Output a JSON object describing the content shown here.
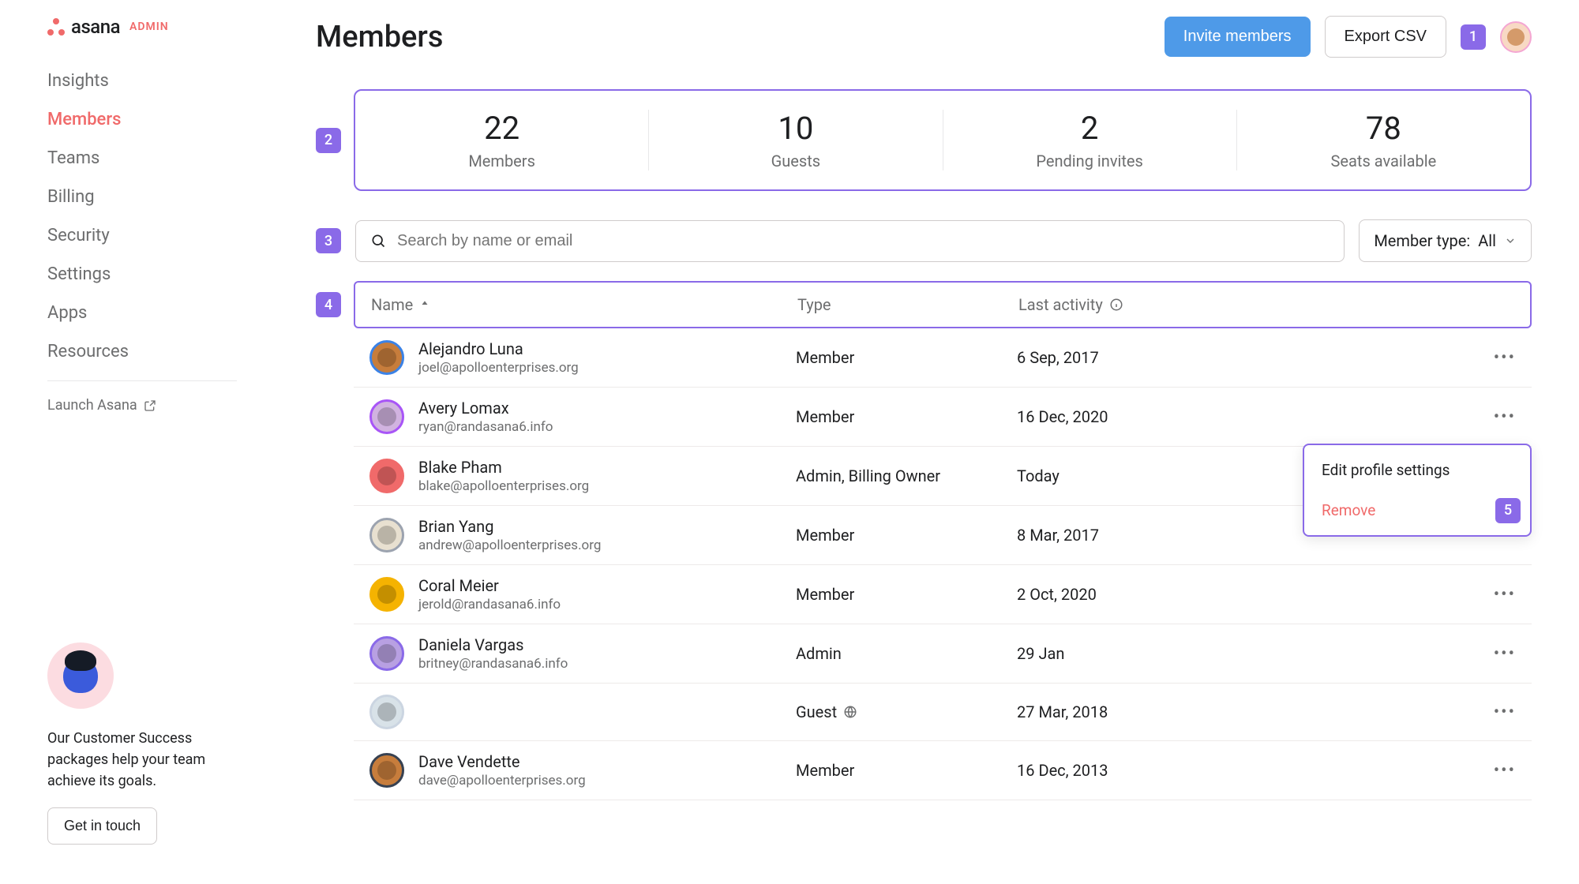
{
  "brand": {
    "name": "asana",
    "suffix": "ADMIN"
  },
  "nav": {
    "items": [
      {
        "label": "Insights"
      },
      {
        "label": "Members"
      },
      {
        "label": "Teams"
      },
      {
        "label": "Billing"
      },
      {
        "label": "Security"
      },
      {
        "label": "Settings"
      },
      {
        "label": "Apps"
      },
      {
        "label": "Resources"
      }
    ],
    "activeIndex": 1,
    "launch": "Launch Asana"
  },
  "csPromo": {
    "text": "Our Customer Success packages help your team achieve its goals.",
    "cta": "Get in touch"
  },
  "header": {
    "title": "Members",
    "invite": "Invite members",
    "export": "Export CSV"
  },
  "callouts": {
    "one": "1",
    "two": "2",
    "three": "3",
    "four": "4",
    "five": "5"
  },
  "stats": {
    "members": {
      "value": "22",
      "label": "Members"
    },
    "guests": {
      "value": "10",
      "label": "Guests"
    },
    "pending": {
      "value": "2",
      "label": "Pending invites"
    },
    "seats": {
      "value": "78",
      "label": "Seats available"
    }
  },
  "search": {
    "placeholder": "Search by name or email"
  },
  "filter": {
    "prefix": "Member type: ",
    "value": "All"
  },
  "columns": {
    "name": "Name",
    "type": "Type",
    "activity": "Last activity"
  },
  "rows": [
    {
      "name": "Alejandro Luna",
      "email": "joel@apolloenterprises.org",
      "type": "Member",
      "activity": "6 Sep, 2017",
      "color": "#c77d3c",
      "ring": "#3b82e6"
    },
    {
      "name": "Avery Lomax",
      "email": "ryan@randasana6.info",
      "type": "Member",
      "activity": "16 Dec, 2020",
      "color": "#d1b3e0",
      "ring": "#a855f7"
    },
    {
      "name": "Blake Pham",
      "email": "blake@apolloenterprises.org",
      "type": "Admin, Billing Owner",
      "activity": "Today",
      "color": "#f06a6a",
      "ring": "#f06a6a"
    },
    {
      "name": "Brian Yang",
      "email": "andrew@apolloenterprises.org",
      "type": "Member",
      "activity": "8 Mar, 2017",
      "color": "#e8e0d0",
      "ring": "#9ca3af"
    },
    {
      "name": "Coral Meier",
      "email": "jerold@randasana6.info",
      "type": "Member",
      "activity": "2 Oct, 2020",
      "color": "#f5b301",
      "ring": "#f5b301"
    },
    {
      "name": "Daniela Vargas",
      "email": "britney@randasana6.info",
      "type": "Admin",
      "activity": "29 Jan",
      "color": "#b8a0e2",
      "ring": "#8a6ae8"
    },
    {
      "name": "",
      "email": "",
      "type": "Guest",
      "activity": "27 Mar, 2018",
      "color": "#d8e2e8",
      "ring": "#cbd5e1",
      "isGuest": true
    },
    {
      "name": "Dave Vendette",
      "email": "dave@apolloenterprises.org",
      "type": "Member",
      "activity": "16 Dec, 2013",
      "color": "#c77d3c",
      "ring": "#374151"
    }
  ],
  "menu": {
    "edit": "Edit profile settings",
    "remove": "Remove"
  }
}
